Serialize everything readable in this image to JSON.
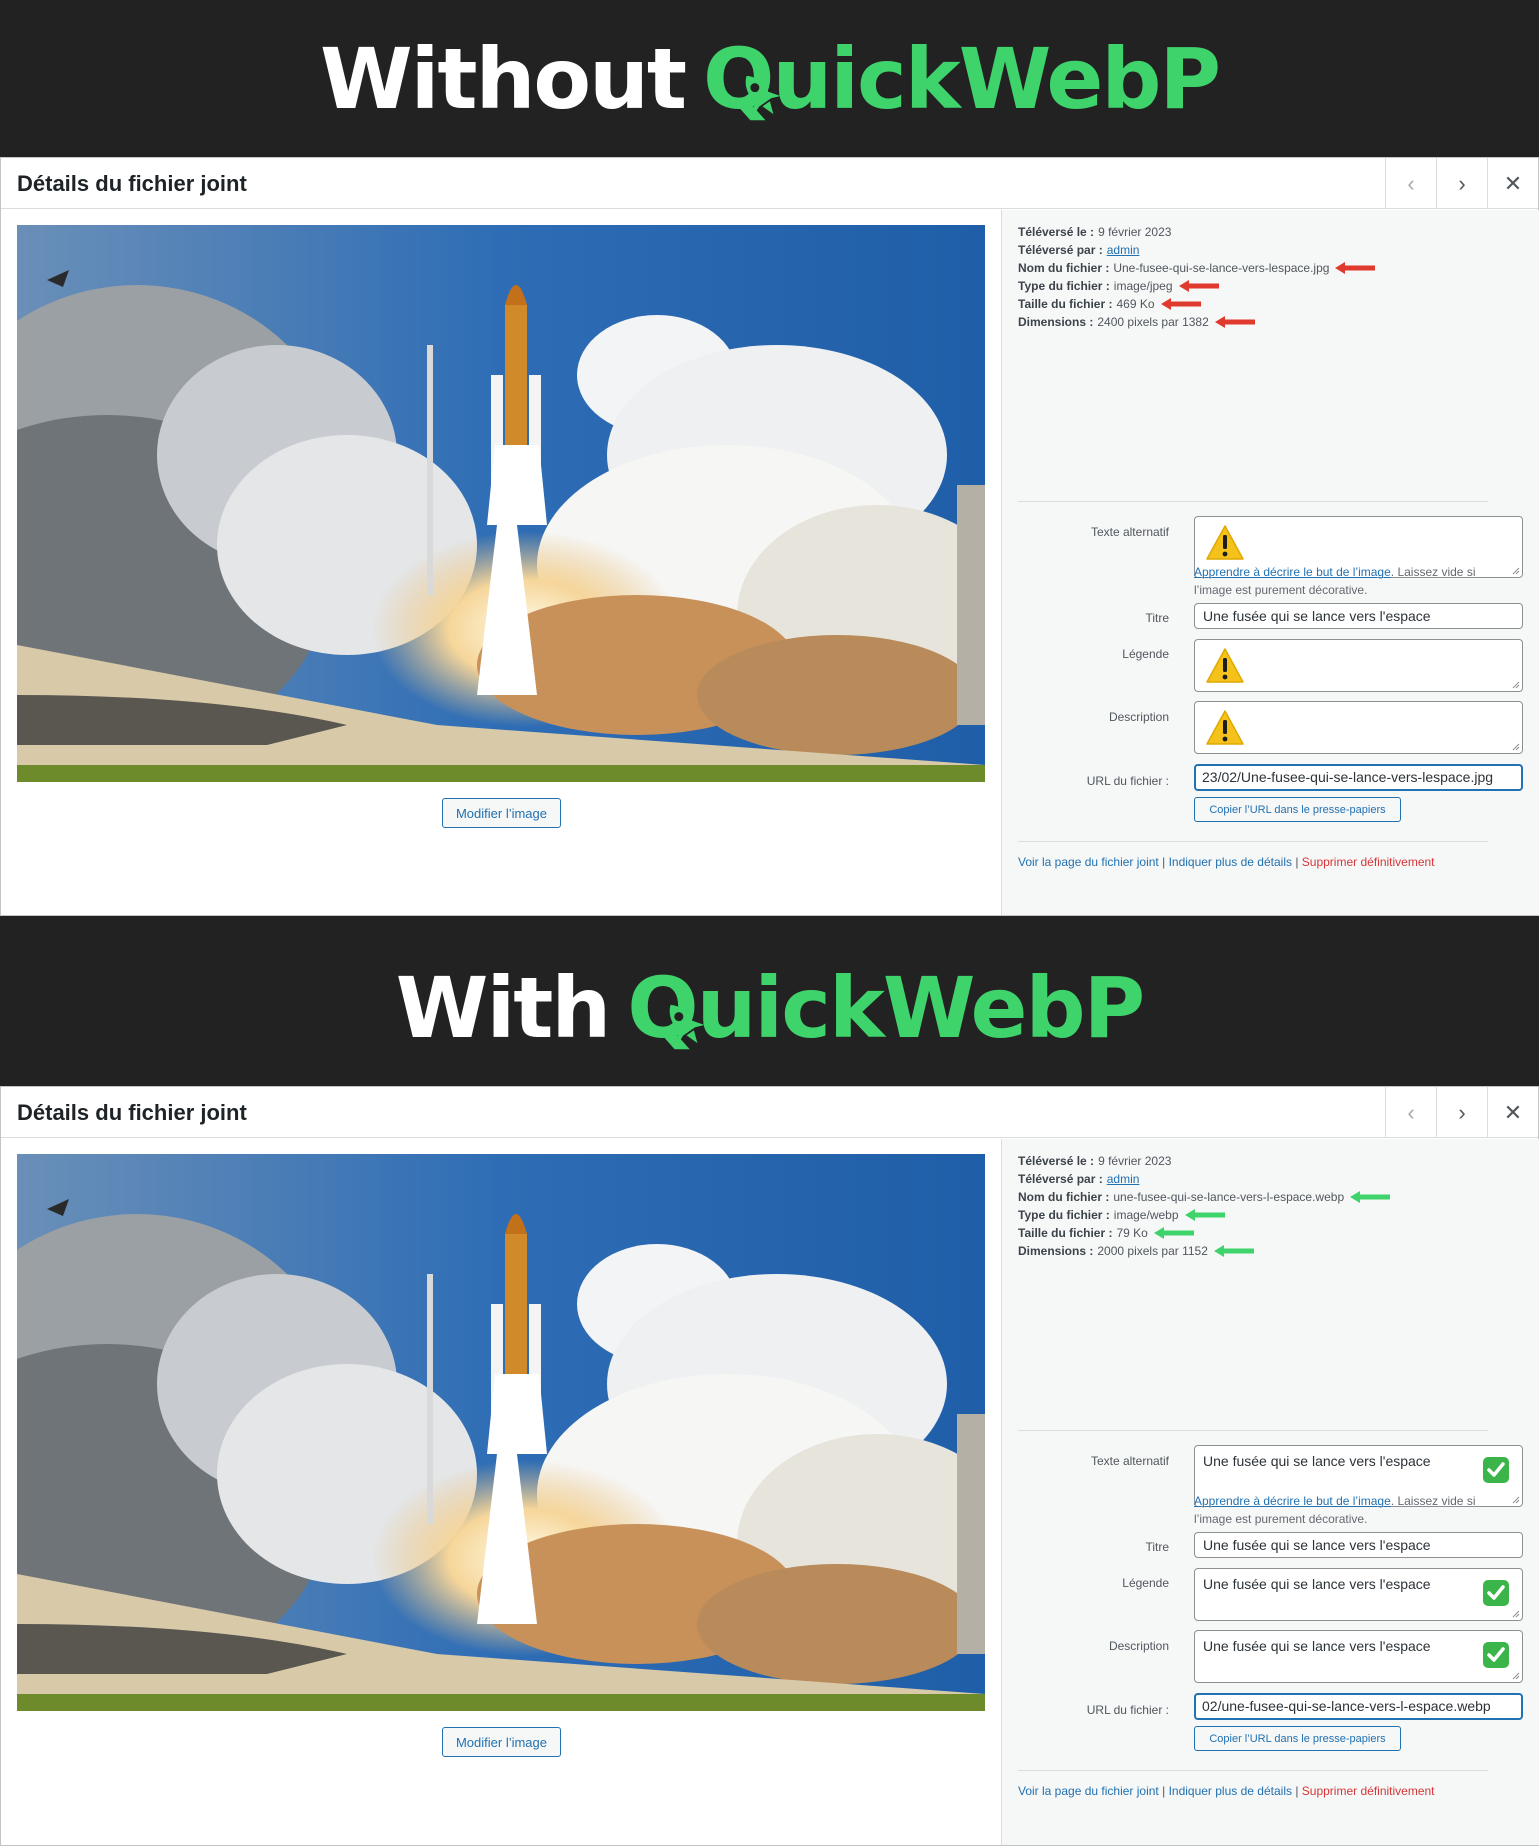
{
  "colors": {
    "accent": "#3fd36c",
    "link": "#2271b1",
    "danger": "#d63638",
    "arrow_bad": "#e03a2f",
    "arrow_good": "#3fd36c"
  },
  "icons": [
    "rocket-icon",
    "chevron-left-icon",
    "chevron-right-icon",
    "close-icon",
    "warning-icon",
    "check-icon",
    "arrow-left-icon"
  ],
  "panels": [
    {
      "banner": {
        "prefix": "Without",
        "brand": "QuickWebP"
      },
      "header": {
        "title": "Détails du fichier joint",
        "prev": "‹",
        "next": "›",
        "close": "✕"
      },
      "edit_button": "Modifier l’image",
      "meta": {
        "uploaded_label": "Téléversé le :",
        "uploaded_value": "9 février 2023",
        "by_label": "Téléversé par :",
        "by_value": "admin",
        "filename_label": "Nom du fichier :",
        "filename_value": "Une-fusee-qui-se-lance-vers-lespace.jpg",
        "type_label": "Type du fichier :",
        "type_value": "image/jpeg",
        "size_label": "Taille du fichier :",
        "size_value": "469 Ko",
        "dim_label": "Dimensions :",
        "dim_value": "2400 pixels par 1382"
      },
      "fields": {
        "alt_label": "Texte alternatif",
        "alt_value": "",
        "help_link": "Apprendre à décrire le but de l’image",
        "help_text": ". Laissez vide si l’image est purement décorative.",
        "title_label": "Titre",
        "title_value": "Une fusée qui se lance vers l'espace",
        "caption_label": "Légende",
        "caption_value": "",
        "desc_label": "Description",
        "desc_value": "",
        "url_label": "URL du fichier :",
        "url_value": "23/02/Une-fusee-qui-se-lance-vers-lespace.jpg",
        "copy_button": "Copier l’URL dans le presse-papiers"
      },
      "links": {
        "view": "Voir la page du fichier joint",
        "sep1": " | ",
        "more": "Indiquer plus de détails",
        "sep2": " | ",
        "delete": "Supprimer définitivement"
      }
    },
    {
      "banner": {
        "prefix": "With",
        "brand": "QuickWebP"
      },
      "header": {
        "title": "Détails du fichier joint",
        "prev": "‹",
        "next": "›",
        "close": "✕"
      },
      "edit_button": "Modifier l’image",
      "meta": {
        "uploaded_label": "Téléversé le :",
        "uploaded_value": "9 février 2023",
        "by_label": "Téléversé par :",
        "by_value": "admin",
        "filename_label": "Nom du fichier :",
        "filename_value": "une-fusee-qui-se-lance-vers-l-espace.webp",
        "type_label": "Type du fichier :",
        "type_value": "image/webp",
        "size_label": "Taille du fichier :",
        "size_value": "79 Ko",
        "dim_label": "Dimensions :",
        "dim_value": "2000 pixels par 1152"
      },
      "fields": {
        "alt_label": "Texte alternatif",
        "alt_value": "Une fusée qui se lance vers l'espace",
        "help_link": "Apprendre à décrire le but de l’image",
        "help_text": ". Laissez vide si l’image est purement décorative.",
        "title_label": "Titre",
        "title_value": "Une fusée qui se lance vers l'espace",
        "caption_label": "Légende",
        "caption_value": "Une fusée qui se lance vers l'espace",
        "desc_label": "Description",
        "desc_value": "Une fusée qui se lance vers l'espace",
        "url_label": "URL du fichier :",
        "url_value": "02/une-fusee-qui-se-lance-vers-l-espace.webp",
        "copy_button": "Copier l’URL dans le presse-papiers"
      },
      "links": {
        "view": "Voir la page du fichier joint",
        "sep1": " | ",
        "more": "Indiquer plus de détails",
        "sep2": " | ",
        "delete": "Supprimer définitivement"
      }
    }
  ]
}
